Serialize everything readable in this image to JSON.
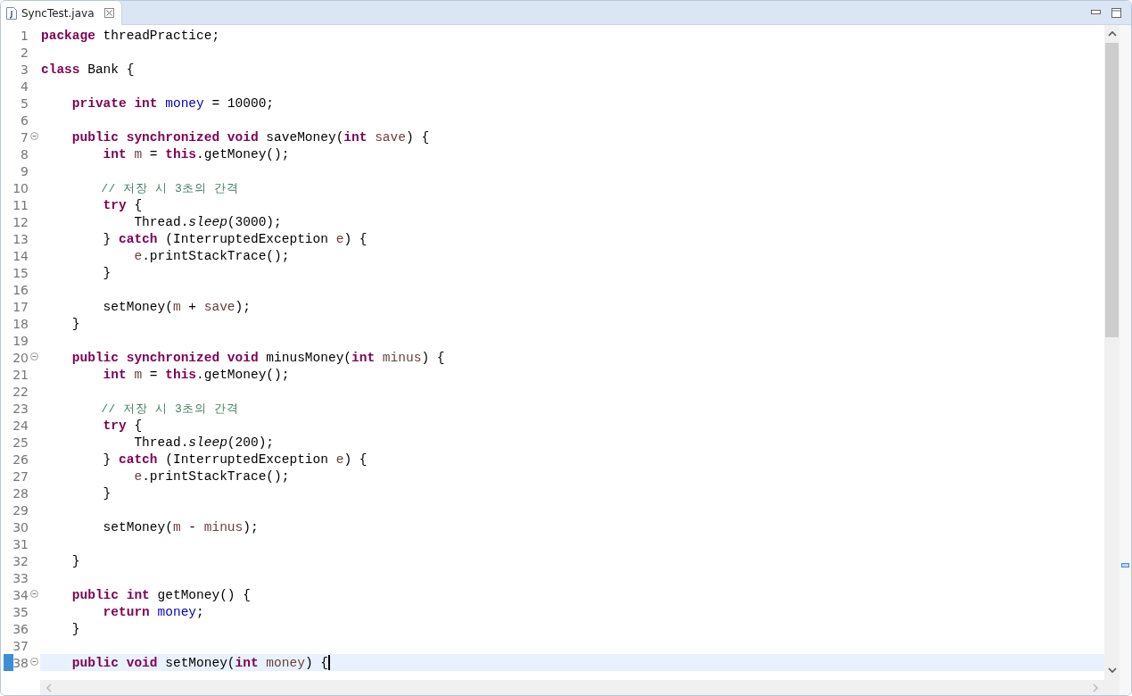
{
  "tab": {
    "label": "SyncTest.java",
    "selected": true
  },
  "lines": [
    {
      "n": "1",
      "tokens": [
        {
          "kind": "kw",
          "text": "package"
        },
        {
          "kind": "plain",
          "text": " threadPractice;"
        }
      ]
    },
    {
      "n": "2"
    },
    {
      "n": "3",
      "tokens": [
        {
          "kind": "kw",
          "text": "class"
        },
        {
          "kind": "plain",
          "text": " Bank {"
        }
      ]
    },
    {
      "n": "4"
    },
    {
      "n": "5",
      "tokens": [
        {
          "kind": "kw",
          "text": "    private int"
        },
        {
          "kind": "field",
          "text": " money"
        },
        {
          "kind": "plain",
          "text": " = 10000;"
        }
      ]
    },
    {
      "n": "6"
    },
    {
      "n": "7",
      "fold": true,
      "tokens": [
        {
          "kind": "kw",
          "text": "    public synchronized void"
        },
        {
          "kind": "plain",
          "text": " saveMoney("
        },
        {
          "kind": "kw",
          "text": "int"
        },
        {
          "kind": "param",
          "text": " save"
        },
        {
          "kind": "plain",
          "text": ") {"
        }
      ]
    },
    {
      "n": "8",
      "tokens": [
        {
          "kind": "kw",
          "text": "        int"
        },
        {
          "kind": "param",
          "text": " m"
        },
        {
          "kind": "plain",
          "text": " = "
        },
        {
          "kind": "kw",
          "text": "this"
        },
        {
          "kind": "plain",
          "text": ".getMoney();"
        }
      ]
    },
    {
      "n": "9"
    },
    {
      "n": "10",
      "tokens": [
        {
          "kind": "comment",
          "text": "        // 저장 시 3초의 간격"
        }
      ]
    },
    {
      "n": "11",
      "tokens": [
        {
          "kind": "kw",
          "text": "        try"
        },
        {
          "kind": "plain",
          "text": " {"
        }
      ]
    },
    {
      "n": "12",
      "tokens": [
        {
          "kind": "plain",
          "text": "            Thread."
        },
        {
          "kind": "static",
          "text": "sleep"
        },
        {
          "kind": "plain",
          "text": "(3000);"
        }
      ]
    },
    {
      "n": "13",
      "tokens": [
        {
          "kind": "plain",
          "text": "        } "
        },
        {
          "kind": "kw",
          "text": "catch"
        },
        {
          "kind": "plain",
          "text": " (InterruptedException "
        },
        {
          "kind": "param",
          "text": "e"
        },
        {
          "kind": "plain",
          "text": ") {"
        }
      ]
    },
    {
      "n": "14",
      "tokens": [
        {
          "kind": "param",
          "text": "            e"
        },
        {
          "kind": "plain",
          "text": ".printStackTrace();"
        }
      ]
    },
    {
      "n": "15",
      "tokens": [
        {
          "kind": "plain",
          "text": "        }"
        }
      ]
    },
    {
      "n": "16"
    },
    {
      "n": "17",
      "tokens": [
        {
          "kind": "plain",
          "text": "        setMoney("
        },
        {
          "kind": "param",
          "text": "m"
        },
        {
          "kind": "plain",
          "text": " + "
        },
        {
          "kind": "param",
          "text": "save"
        },
        {
          "kind": "plain",
          "text": ");"
        }
      ]
    },
    {
      "n": "18",
      "tokens": [
        {
          "kind": "plain",
          "text": "    }"
        }
      ]
    },
    {
      "n": "19"
    },
    {
      "n": "20",
      "fold": true,
      "tokens": [
        {
          "kind": "kw",
          "text": "    public synchronized void"
        },
        {
          "kind": "plain",
          "text": " minusMoney("
        },
        {
          "kind": "kw",
          "text": "int"
        },
        {
          "kind": "param",
          "text": " minus"
        },
        {
          "kind": "plain",
          "text": ") {"
        }
      ]
    },
    {
      "n": "21",
      "tokens": [
        {
          "kind": "kw",
          "text": "        int"
        },
        {
          "kind": "param",
          "text": " m"
        },
        {
          "kind": "plain",
          "text": " = "
        },
        {
          "kind": "kw",
          "text": "this"
        },
        {
          "kind": "plain",
          "text": ".getMoney();"
        }
      ]
    },
    {
      "n": "22"
    },
    {
      "n": "23",
      "tokens": [
        {
          "kind": "comment",
          "text": "        // 저장 시 3초의 간격"
        }
      ]
    },
    {
      "n": "24",
      "tokens": [
        {
          "kind": "kw",
          "text": "        try"
        },
        {
          "kind": "plain",
          "text": " {"
        }
      ]
    },
    {
      "n": "25",
      "tokens": [
        {
          "kind": "plain",
          "text": "            Thread."
        },
        {
          "kind": "static",
          "text": "sleep"
        },
        {
          "kind": "plain",
          "text": "(200);"
        }
      ]
    },
    {
      "n": "26",
      "tokens": [
        {
          "kind": "plain",
          "text": "        } "
        },
        {
          "kind": "kw",
          "text": "catch"
        },
        {
          "kind": "plain",
          "text": " (InterruptedException "
        },
        {
          "kind": "param",
          "text": "e"
        },
        {
          "kind": "plain",
          "text": ") {"
        }
      ]
    },
    {
      "n": "27",
      "tokens": [
        {
          "kind": "param",
          "text": "            e"
        },
        {
          "kind": "plain",
          "text": ".printStackTrace();"
        }
      ]
    },
    {
      "n": "28",
      "tokens": [
        {
          "kind": "plain",
          "text": "        }"
        }
      ]
    },
    {
      "n": "29"
    },
    {
      "n": "30",
      "tokens": [
        {
          "kind": "plain",
          "text": "        setMoney("
        },
        {
          "kind": "param",
          "text": "m"
        },
        {
          "kind": "plain",
          "text": " - "
        },
        {
          "kind": "param",
          "text": "minus"
        },
        {
          "kind": "plain",
          "text": ");"
        }
      ]
    },
    {
      "n": "31"
    },
    {
      "n": "32",
      "tokens": [
        {
          "kind": "plain",
          "text": "    }"
        }
      ]
    },
    {
      "n": "33"
    },
    {
      "n": "34",
      "fold": true,
      "tokens": [
        {
          "kind": "kw",
          "text": "    public int"
        },
        {
          "kind": "plain",
          "text": " getMoney() {"
        }
      ]
    },
    {
      "n": "35",
      "tokens": [
        {
          "kind": "kw",
          "text": "        return"
        },
        {
          "kind": "field",
          "text": " money"
        },
        {
          "kind": "plain",
          "text": ";"
        }
      ]
    },
    {
      "n": "36",
      "tokens": [
        {
          "kind": "plain",
          "text": "    }"
        }
      ]
    },
    {
      "n": "37"
    },
    {
      "n": "38",
      "fold": true,
      "current": true,
      "tokens": [
        {
          "kind": "kw",
          "text": "    public void"
        },
        {
          "kind": "plain",
          "text": " setMoney("
        },
        {
          "kind": "kw",
          "text": "int"
        },
        {
          "kind": "param",
          "text": " money"
        },
        {
          "kind": "plain",
          "text": ") {"
        }
      ]
    }
  ]
}
